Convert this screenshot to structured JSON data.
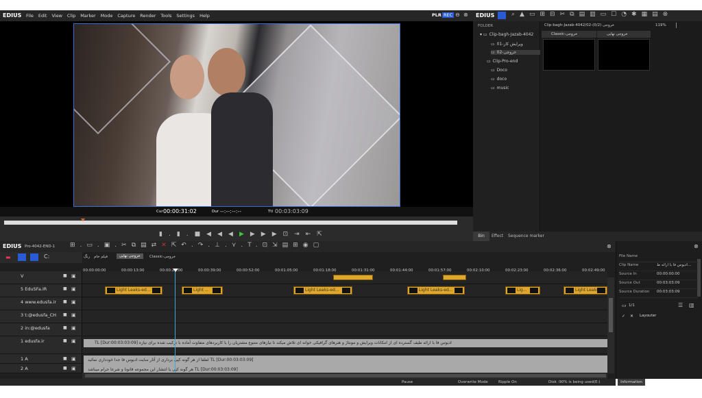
{
  "app": {
    "logo": "EDIUS",
    "menu": [
      "File",
      "Edit",
      "View",
      "Clip",
      "Marker",
      "Mode",
      "Capture",
      "Render",
      "Tools",
      "Settings",
      "Help"
    ],
    "plr": "PLR",
    "rec": "REC"
  },
  "player": {
    "cur_label": "Cur",
    "cur": "00:00:31:02",
    "dur_label": "Dur",
    "dur": "--:--:--:--",
    "ttl_label": "Ttl",
    "ttl": "00:03:03:09"
  },
  "bin": {
    "logo": "EDIUS",
    "folder_label": "FOLDER",
    "path": "Clip-bagh-Jazab-4042/02-خروجی (0/2)",
    "zoom": "119%",
    "folders": [
      "Clip-bagh-Jazab-4042",
      "ویرایش کار-01",
      "02-خروجی",
      "Clip-Pro-end",
      "Doco",
      "doco",
      "music"
    ],
    "clips": [
      "Classic-خروجی",
      "خروجی نهایی"
    ],
    "tabs": [
      "Bin",
      "Effect",
      "Sequence marker"
    ]
  },
  "timeline": {
    "logo": "EDIUS",
    "project": "Pro-4042-END-1",
    "seq_tabs": [
      "رنگ",
      "فیلم خام",
      "خروجی نهایی",
      "Classic-خروجی"
    ],
    "ticks": [
      "00:00:00;00",
      "00:00:13;00",
      "00:00:26;00",
      "00:00:39;00",
      "00:00:52;00",
      "00:01:05;00",
      "00:01:18;00",
      "00:01:31;00",
      "00:01:44;00",
      "00:01:57;00",
      "00:02:10;00",
      "00:02:23;00",
      "00:02:36;00",
      "00:02:49;00"
    ],
    "tracks": [
      "V",
      "5 EduSFa.IR",
      "4 www.edusfa.ir",
      "3 t:@edusfa_CH",
      "2 in:@edusfa",
      "1 edusfa.ir",
      "1 A",
      "2 A"
    ],
    "clip_label": "Light Leaks-ed...",
    "clip_short": "Light ...",
    "clip_tiny": "Lig...",
    "video_clip": "ادیوس فا با ارائه طیف گسترده ای از امکانات ویرایش و مونتاژ و هنرهای گرافیکی خوانه ای تلاش میکند تا نیازهای متنوع مشتریان را با کاربردهای متفاوت آماده با ترکیب شده برای نیازه TL [Dur:00:03:03:09]",
    "audio1": "لطفا از هر گونه کپی برداری از آثار سایت ادیوس فا جدا خودداری نمائید TL [Dur:00:03:03:09]",
    "audio2": "هر گونه کپی یا انتشار این مجموعه قانونا و شرعا حرام میباشد TL [Dur:00:03:03:09]"
  },
  "info": {
    "rows": [
      [
        "File Name",
        ""
      ],
      [
        "Clip Name",
        "ادیوس فا با ارائه ط..."
      ],
      [
        "Source In",
        "00:00:00:00"
      ],
      [
        "Source Out",
        "00:03:03:09"
      ],
      [
        "Source Duration",
        "00:03:03:09"
      ]
    ],
    "count": "1/1",
    "effect": "Layouter",
    "tab": "Information"
  },
  "status": {
    "pause": "Pause",
    "mode": "Overwrite Mode",
    "ripple": "Ripple On",
    "disk": "Disk :90% is being used(E:)"
  }
}
